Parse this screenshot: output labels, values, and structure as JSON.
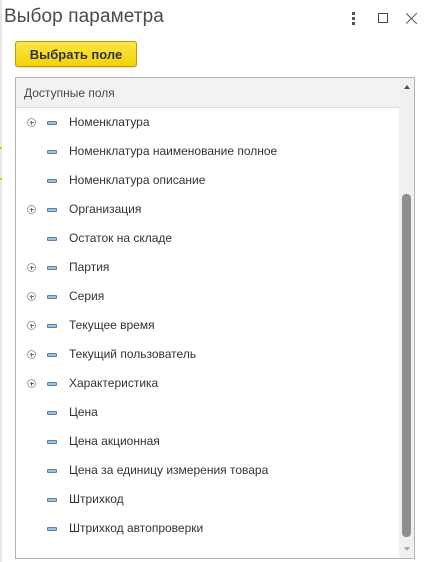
{
  "window": {
    "title": "Выбор параметра"
  },
  "toolbar": {
    "select_field_label": "Выбрать поле"
  },
  "fields_panel": {
    "header": "Доступные поля",
    "rows": [
      {
        "label": "Номенклатура",
        "expandable": true
      },
      {
        "label": "Номенклатура наименование полное",
        "expandable": false
      },
      {
        "label": "Номенклатура описание",
        "expandable": false
      },
      {
        "label": "Организация",
        "expandable": true
      },
      {
        "label": "Остаток на складе",
        "expandable": false
      },
      {
        "label": "Партия",
        "expandable": true
      },
      {
        "label": "Серия",
        "expandable": true
      },
      {
        "label": "Текущее время",
        "expandable": true
      },
      {
        "label": "Текущий пользователь",
        "expandable": true
      },
      {
        "label": "Характеристика",
        "expandable": true
      },
      {
        "label": "Цена",
        "expandable": false
      },
      {
        "label": "Цена акционная",
        "expandable": false
      },
      {
        "label": "Цена за единицу измерения товара",
        "expandable": false
      },
      {
        "label": "Штрихкод",
        "expandable": false
      },
      {
        "label": "Штрихкод автопроверки",
        "expandable": false
      }
    ]
  },
  "colors": {
    "accent_button": "#f4d204",
    "field_icon": "#9cc2e0"
  }
}
